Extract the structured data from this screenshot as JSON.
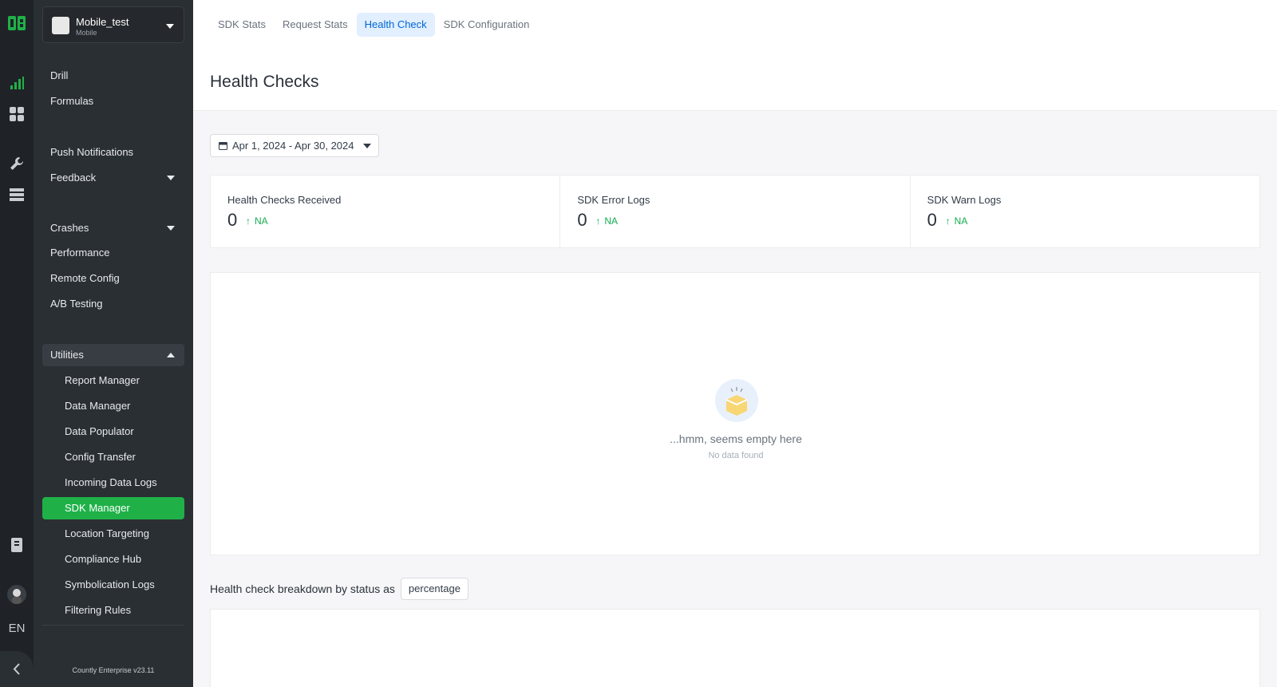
{
  "app": {
    "name": "Mobile_test",
    "type": "Mobile"
  },
  "rail": {
    "icons": [
      "countly-logo-icon",
      "analytics-icon",
      "dashboards-icon",
      "management-icon",
      "data-icon",
      "documentation-icon",
      "avatar",
      "collapse-icon"
    ],
    "language": "EN"
  },
  "sidebar": {
    "items": [
      {
        "label": "Drill"
      },
      {
        "label": "Formulas"
      },
      {
        "label": "Push Notifications"
      },
      {
        "label": "Feedback"
      },
      {
        "label": "Crashes"
      },
      {
        "label": "Performance"
      },
      {
        "label": "Remote Config"
      },
      {
        "label": "A/B Testing"
      },
      {
        "label": "Utilities"
      },
      {
        "label": "Report Manager"
      },
      {
        "label": "Data Manager"
      },
      {
        "label": "Data Populator"
      },
      {
        "label": "Config Transfer"
      },
      {
        "label": "Incoming Data Logs"
      },
      {
        "label": "SDK Manager"
      },
      {
        "label": "Location Targeting"
      },
      {
        "label": "Compliance Hub"
      },
      {
        "label": "Symbolication Logs"
      },
      {
        "label": "Filtering Rules"
      }
    ],
    "version": "Countly Enterprise v23.11"
  },
  "tabs": [
    {
      "label": "SDK Stats"
    },
    {
      "label": "Request Stats"
    },
    {
      "label": "Health Check"
    },
    {
      "label": "SDK Configuration"
    }
  ],
  "page_title": "Health Checks",
  "date_range": "Apr 1, 2024 - Apr 30, 2024",
  "stats": [
    {
      "label": "Health Checks Received",
      "value": "0",
      "trend": "NA"
    },
    {
      "label": "SDK Error Logs",
      "value": "0",
      "trend": "NA"
    },
    {
      "label": "SDK Warn Logs",
      "value": "0",
      "trend": "NA"
    }
  ],
  "empty_state": {
    "title": "...hmm, seems empty here",
    "subtitle": "No data found"
  },
  "breakdown": {
    "label": "Health check breakdown by status as",
    "mode": "percentage"
  },
  "colors": {
    "accent": "#1fb148",
    "tab_active": "#0166d6",
    "trend_up": "#12af51",
    "sidebar_bg": "#2a2f34"
  }
}
